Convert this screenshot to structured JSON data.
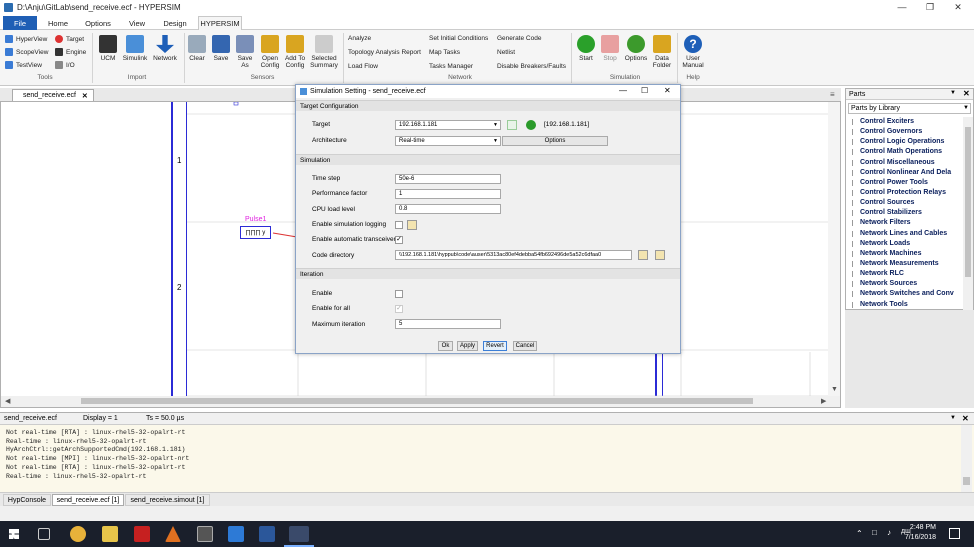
{
  "window": {
    "title": "D:\\Anju\\GitLab\\send_receive.ecf - HYPERSIM"
  },
  "menu": {
    "tabs": [
      "File",
      "Home",
      "Options",
      "View",
      "Design",
      "HYPERSIM"
    ]
  },
  "ribbon": {
    "tools": {
      "hyperview": "HyperView",
      "target": "Target",
      "scopeview": "ScopeView",
      "engine": "Engine",
      "testview": "TestView",
      "io": "I/O",
      "label": "Tools"
    },
    "import": {
      "ucm": "UCM",
      "simulink": "Simulink",
      "network": "Network",
      "label": "Import"
    },
    "sensors": {
      "clear": "Clear",
      "save": "Save",
      "save_as": "Save As",
      "open_config": "Open Config",
      "add_to_config": "Add To Config",
      "selected_summary": "Selected Summary",
      "label": "Sensors"
    },
    "network": {
      "analyze": "Analyze",
      "topology": "Topology Analysis Report",
      "load_flow": "Load Flow",
      "set_initial": "Set Initial Conditions",
      "map_tasks": "Map Tasks",
      "tasks_manager": "Tasks Manager",
      "generate_code": "Generate Code",
      "netlist": "Netlist",
      "disable_breakers": "Disable Breakers/Faults",
      "label": "Network"
    },
    "simulation": {
      "start": "Start",
      "stop": "Stop",
      "options": "Options",
      "data_folder": "Data Folder",
      "label": "Simulation"
    },
    "help": {
      "user_manual": "User Manual",
      "label": "Help"
    }
  },
  "document": {
    "tab": "send_receive.ecf",
    "row1": "1",
    "row2": "2",
    "block_label": "Pulse1",
    "block_text": "∏∏∏ y"
  },
  "parts": {
    "title": "Parts",
    "dropdown": "Parts by Library",
    "items": [
      "Control Exciters",
      "Control Governors",
      "Control Logic Operations",
      "Control Math Operations",
      "Control Miscellaneous",
      "Control Nonlinear And Dela",
      "Control Power Tools",
      "Control Protection Relays",
      "Control Sources",
      "Control Stabilizers",
      "Network Filters",
      "Network Lines and Cables",
      "Network Loads",
      "Network Machines",
      "Network Measurements",
      "Network RLC",
      "Network Sources",
      "Network Switches and Conv",
      "Network Tools"
    ]
  },
  "dialog": {
    "title": "Simulation Setting - send_receive.ecf",
    "sections": {
      "target_config": "Target Configuration",
      "simulation": "Simulation",
      "iteration": "Iteration"
    },
    "target_label": "Target",
    "target_value": "192.168.1.181",
    "target_status": "[192.168.1.181]",
    "architecture_label": "Architecture",
    "architecture_value": "Real-time",
    "options_button": "Options",
    "time_step_label": "Time step",
    "time_step_value": "50e-6",
    "perf_factor_label": "Performance factor",
    "perf_factor_value": "1",
    "cpu_load_label": "CPU load level",
    "cpu_load_value": "0.8",
    "sim_logging_label": "Enable simulation logging",
    "auto_transceiver_label": "Enable automatic transceiver",
    "code_dir_label": "Code directory",
    "code_dir_value": "\\\\192.168.1.181\\hyppub\\code\\auser\\5313ac80ef4debba54fb692496de5a52c6dfaa0",
    "iter_enable_label": "Enable",
    "iter_enable_all_label": "Enable for all",
    "max_iter_label": "Maximum iteration",
    "max_iter_value": "5",
    "ok": "Ok",
    "apply": "Apply",
    "revert": "Revert",
    "cancel": "Cancel"
  },
  "status": {
    "file": "send_receive.ecf",
    "display": "Display = 1",
    "ts": "Ts = 50.0 µs"
  },
  "console": {
    "lines": [
      "Not real-time [RTA] : linux-rhel5-32-opalrt-rt",
      "Real-time : linux-rhel5-32-opalrt-rt",
      "HyArchCtrl::getArchSupportedCmd(192.168.1.181)",
      "Not real-time [MPI] : linux-rhel5-32-opalrt-nrt",
      "Not real-time [RTA] : linux-rhel5-32-opalrt-rt",
      "Real-time : linux-rhel5-32-opalrt-rt"
    ],
    "tabs": [
      "HypConsole",
      "send_receive.ecf [1]",
      "send_receive.simout [1]"
    ]
  },
  "taskbar": {
    "time": "2:48 PM",
    "date": "7/16/2018"
  }
}
